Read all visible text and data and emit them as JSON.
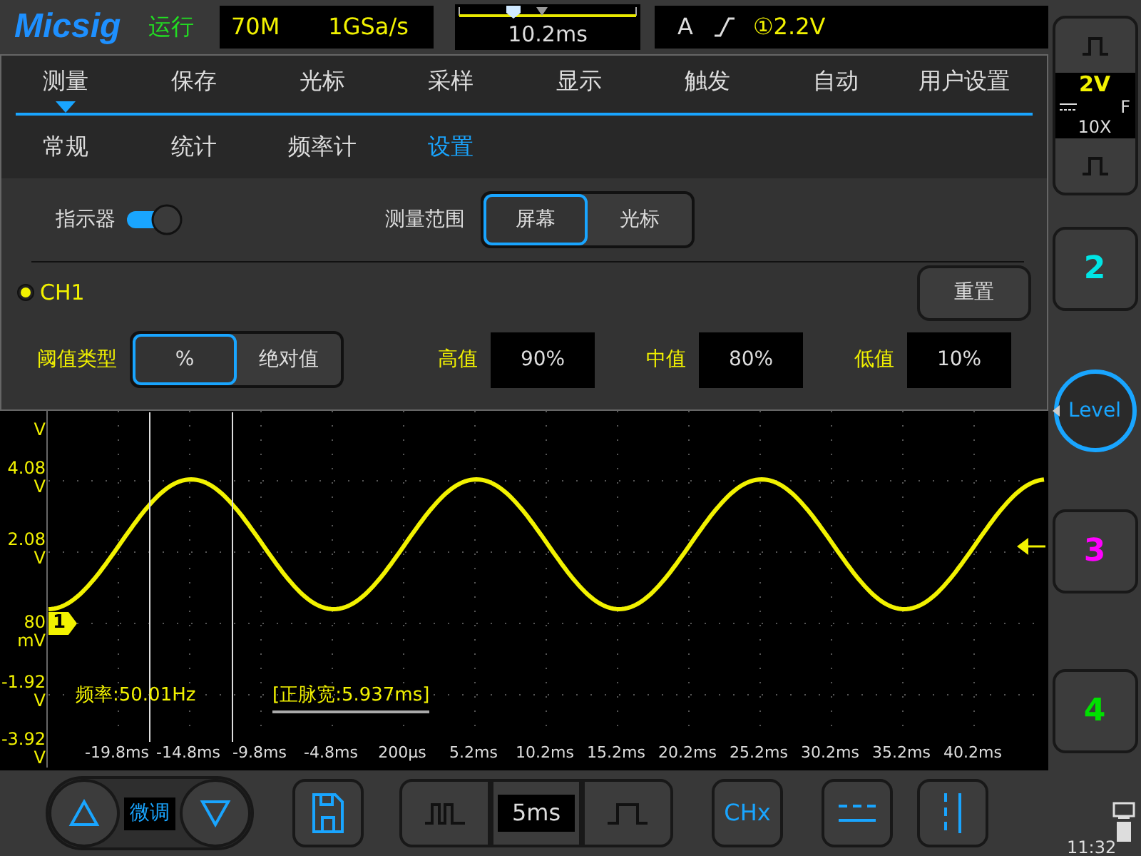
{
  "top_bar": {
    "logo": "Micsig",
    "run_state": "运行",
    "bandwidth": "70M",
    "sample_rate": "1GSa/s",
    "horizontal_position": "10.2ms",
    "trigger_mode": "A",
    "trigger_level": "①2.2V"
  },
  "menu": {
    "tabs": [
      {
        "label": "测量",
        "selected": true
      },
      {
        "label": "保存",
        "selected": false
      },
      {
        "label": "光标",
        "selected": false
      },
      {
        "label": "采样",
        "selected": false
      },
      {
        "label": "显示",
        "selected": false
      },
      {
        "label": "触发",
        "selected": false
      },
      {
        "label": "自动",
        "selected": false
      },
      {
        "label": "用户设置",
        "selected": false
      }
    ],
    "subtabs": [
      {
        "label": "常规",
        "selected": false
      },
      {
        "label": "统计",
        "selected": false
      },
      {
        "label": "频率计",
        "selected": false
      },
      {
        "label": "设置",
        "selected": true
      }
    ],
    "indicator": {
      "label": "指示器",
      "on": true
    },
    "measure_range": {
      "label": "测量范围",
      "options": [
        {
          "label": "屏幕",
          "selected": true
        },
        {
          "label": "光标",
          "selected": false
        }
      ]
    },
    "channel": {
      "label": "CH1",
      "selected": true
    },
    "reset_button": "重置",
    "threshold_type": {
      "label": "阈值类型",
      "options": [
        {
          "label": "%",
          "selected": true
        },
        {
          "label": "绝对值",
          "selected": false
        }
      ]
    },
    "thresholds": [
      {
        "label": "高值",
        "value": "90%"
      },
      {
        "label": "中值",
        "value": "80%"
      },
      {
        "label": "低值",
        "value": "10%"
      }
    ]
  },
  "scope": {
    "y_labels": [
      {
        "unit": "V"
      },
      {
        "value": "4.08",
        "unit": "V"
      },
      {
        "value": "2.08",
        "unit": "V"
      },
      {
        "value": "80",
        "unit": "mV"
      },
      {
        "value": "-1.92",
        "unit": "V"
      },
      {
        "value": "-3.92",
        "unit": "V"
      }
    ],
    "x_labels": [
      "-19.8ms",
      "-14.8ms",
      "-9.8ms",
      "-4.8ms",
      "200μs",
      "5.2ms",
      "10.2ms",
      "15.2ms",
      "20.2ms",
      "25.2ms",
      "30.2ms",
      "35.2ms",
      "40.2ms"
    ],
    "channel_marker": "1",
    "measurements": [
      {
        "text": "频率:50.01Hz",
        "selected": false
      },
      {
        "text": "[正脉宽:5.937ms]",
        "selected": true
      }
    ]
  },
  "right_panel": {
    "ch1": {
      "scale": "2V",
      "coupling": "F",
      "probe": "10X"
    },
    "buttons": [
      {
        "kind": "channel",
        "label": "2",
        "color": "#00e5e5"
      },
      {
        "kind": "level",
        "label": "Level"
      },
      {
        "kind": "channel",
        "label": "3",
        "color": "#ff00ff"
      },
      {
        "kind": "channel",
        "label": "4",
        "color": "#00e000"
      }
    ],
    "clock": "11:32"
  },
  "bottom_bar": {
    "fine_label": "微调",
    "timebase": "5ms",
    "channel_button": "CHx"
  }
}
